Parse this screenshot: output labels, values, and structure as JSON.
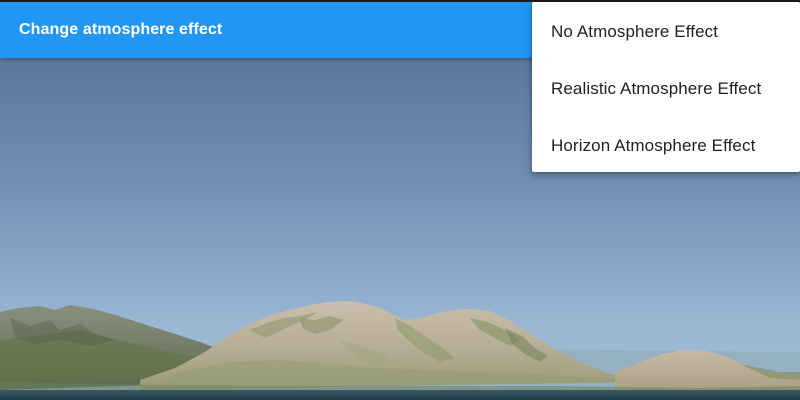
{
  "toolbar": {
    "button_label": "Change atmosphere effect",
    "color": "#2196f3"
  },
  "menu": {
    "items": [
      {
        "label": "No Atmosphere Effect"
      },
      {
        "label": "Realistic Atmosphere Effect"
      },
      {
        "label": "Horizon Atmosphere Effect"
      }
    ]
  },
  "scene": {
    "sky_top_color": "#516f96",
    "sky_horizon_color": "#a2bfd8",
    "ground_color": "#1e3f4e"
  }
}
